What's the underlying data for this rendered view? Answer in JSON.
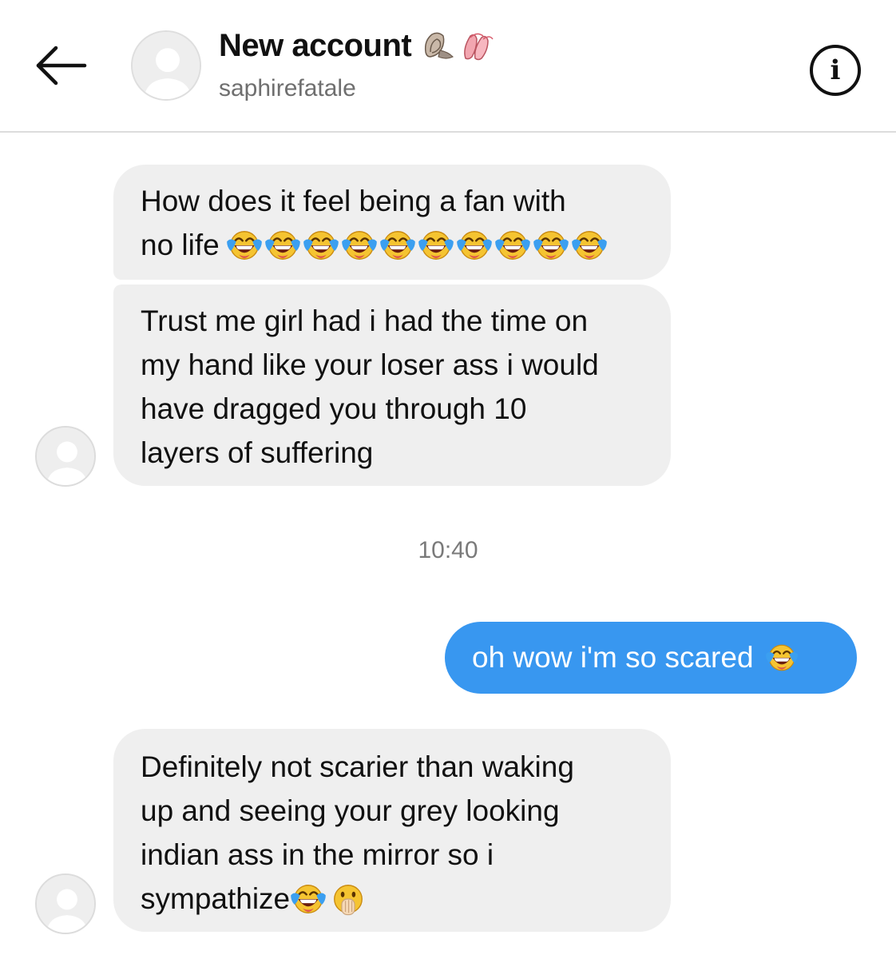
{
  "header": {
    "back_icon": "arrow-left-icon",
    "title": "New account",
    "title_emojis": [
      "spiral-shell-emoji",
      "ballet-shoes-emoji"
    ],
    "username": "saphirefatale",
    "info_icon": "info-icon"
  },
  "messages": [
    {
      "sender": "other",
      "lines": [
        "How does it feel being a fan with",
        "no life"
      ],
      "trailing_emoji": "face-with-tears-of-joy-emoji",
      "trailing_emoji_count": 10
    },
    {
      "sender": "other",
      "lines": [
        "Trust me girl had i had the time on",
        "my hand like your loser ass i would",
        "have dragged you through 10",
        "layers of suffering"
      ]
    },
    {
      "sender": "me",
      "text": "oh wow i'm so scared",
      "trailing_emoji": "face-with-tears-of-joy-emoji"
    },
    {
      "sender": "other",
      "lines": [
        "Definitely not scarier than waking",
        "up and seeing your grey looking",
        "indian ass in the mirror so i",
        "sympathize"
      ],
      "trailing_emojis": [
        "face-with-tears-of-joy-emoji",
        "face-with-open-eyes-and-hand-over-mouth-emoji"
      ]
    }
  ],
  "timestamp": "10:40",
  "colors": {
    "sent_bubble": "#3897f0",
    "received_bubble": "#efefef",
    "divider": "#dcdcdc"
  }
}
